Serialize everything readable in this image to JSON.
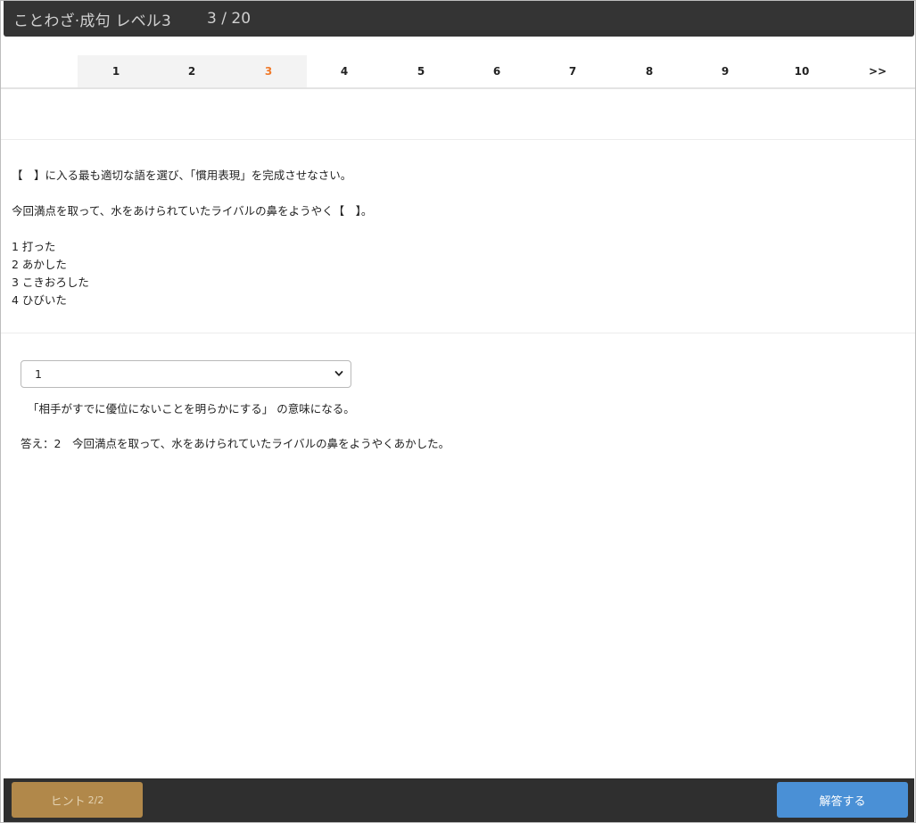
{
  "header": {
    "title": "ことわざ·成句 レベル3",
    "progress": "3 / 20"
  },
  "pager": {
    "pages": [
      "1",
      "2",
      "3",
      "4",
      "5",
      "6",
      "7",
      "8",
      "9",
      "10"
    ],
    "next_label": ">>",
    "current": "3"
  },
  "question": {
    "instruction": "【　】に入る最も適切な語を選び、「慣用表現」を完成させなさい。",
    "sentence": "今回満点を取って、水をあけられていたライバルの鼻をようやく【　】。",
    "options": [
      "1 打った",
      "2 あかした",
      "3 こきおろした",
      "4 ひびいた"
    ]
  },
  "answer_area": {
    "selected_value": "1",
    "explanation": "「相手がすでに優位にないことを明らかにする」 の意味になる。",
    "answer_text": "答え：2　今回満点を取って、水をあけられていたライバルの鼻をようやくあかした。"
  },
  "footer": {
    "hint_label": "ヒント",
    "hint_count": "2/2",
    "submit_label": "解答する"
  },
  "colors": {
    "header_bg": "#343434",
    "current_page": "#f07a2a",
    "hint_button": "#b1884a",
    "submit_button": "#4a90d6"
  },
  "icons": {
    "select_arrow": "chevron-down-icon"
  }
}
